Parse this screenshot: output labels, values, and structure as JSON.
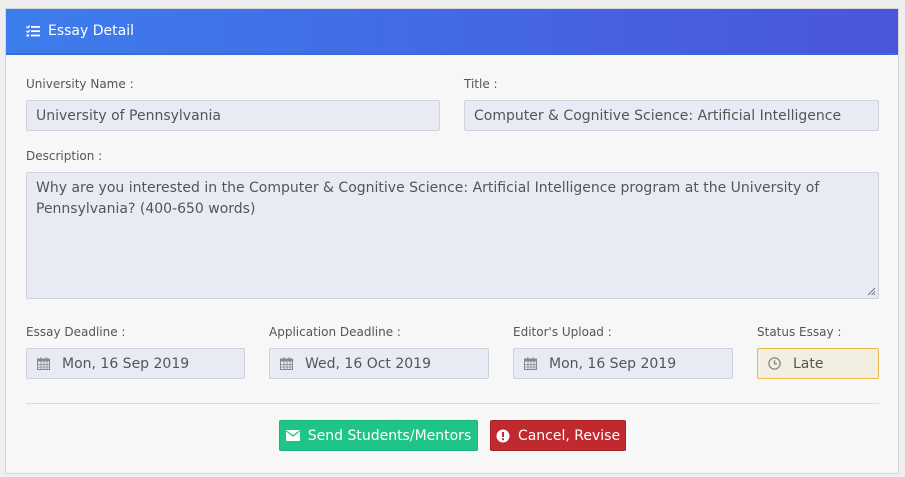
{
  "header": {
    "title": "Essay Detail",
    "icon": "list-check-icon"
  },
  "form": {
    "university_label": "University Name :",
    "university_value": "University of Pennsylvania",
    "title_label": "Title :",
    "title_value": "Computer & Cognitive Science: Artificial Intelligence",
    "description_label": "Description :",
    "description_value": "Why are you interested in the Computer & Cognitive Science: Artificial Intelligence program at the University of Pennsylvania? (400-650 words)",
    "essay_deadline_label": "Essay Deadline :",
    "essay_deadline_value": "Mon, 16 Sep 2019",
    "application_deadline_label": "Application Deadline :",
    "application_deadline_value": "Wed, 16 Oct 2019",
    "editors_upload_label": "Editor's Upload :",
    "editors_upload_value": "Mon, 16 Sep 2019",
    "status_label": "Status Essay :",
    "status_value": "Late"
  },
  "actions": {
    "send_label": "Send Students/Mentors",
    "cancel_label": "Cancel, Revise"
  },
  "colors": {
    "header_start": "#3d7ded",
    "header_end": "#4a55db",
    "send": "#1fc587",
    "cancel": "#c0292d",
    "status_border": "#e8b84a"
  }
}
